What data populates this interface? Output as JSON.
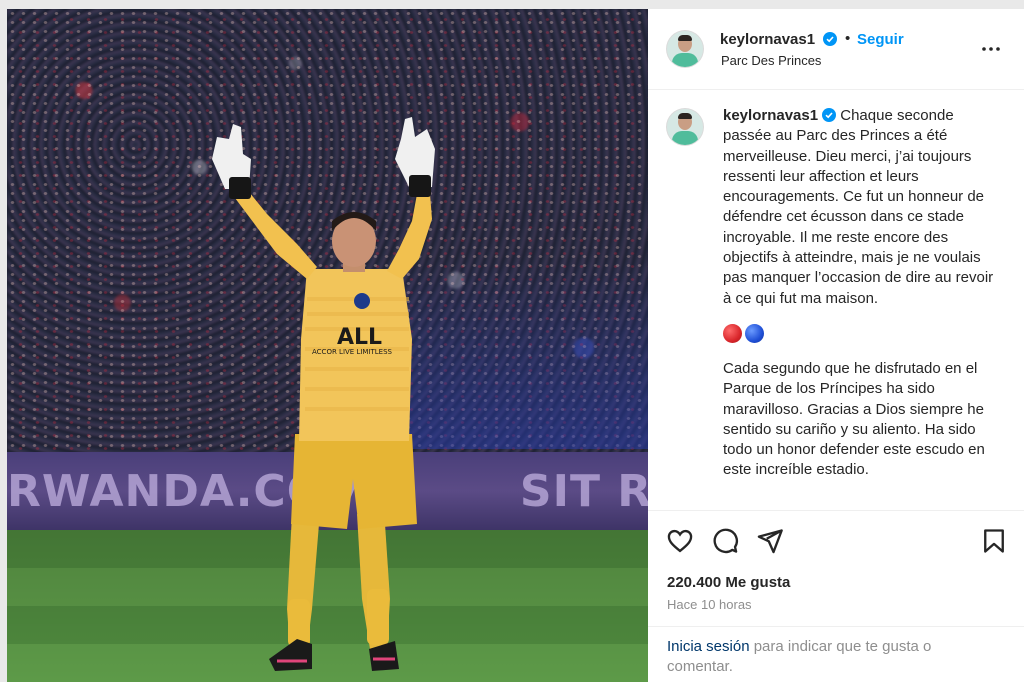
{
  "post": {
    "username": "keylornavas1",
    "follow_label": "Seguir",
    "separator": "•",
    "location": "Parc Des Princes",
    "caption_fr": "Chaque seconde passée au Parc des Princes a été merveilleuse. Dieu merci, j’ai toujours ressenti leur affection et leurs encouragements. Ce fut un honneur de défendre cet écusson dans ce stade incroyable. Il me reste encore des objectifs à atteindre, mais je ne voulais pas manquer l’occasion de dire au revoir à ce qui fut ma maison.",
    "caption_es": "Cada segundo que he disfrutado en el Parque de los Príncipes ha sido maravilloso. Gracias a Dios siempre he sentido su cariño y su aliento. Ha sido todo un honor defender este escudo en este increíble estadio.",
    "emoji_colors": [
      "#d9262b",
      "#1f4fd6"
    ],
    "likes": "220.400 Me gusta",
    "time_ago": "Hace 10 horas"
  },
  "photo": {
    "ad_text_1": "RWANDA.COM",
    "ad_text_2": "SIT  RWANDA",
    "sponsor": "ALL",
    "sponsor_sub": "ACCOR LIVE LIMITLESS"
  },
  "login": {
    "link": "Inicia sesión",
    "rest": " para indicar que te gusta o comentar."
  },
  "icons": {
    "like": "heart-icon",
    "comment": "comment-icon",
    "share": "share-icon",
    "save": "bookmark-icon",
    "more": "more-options-icon",
    "verified": "verified-badge-icon"
  },
  "colors": {
    "link_blue": "#0095f6",
    "verified_blue": "#0095f6",
    "secondary_text": "#8e8e8e",
    "border": "#efefef"
  }
}
